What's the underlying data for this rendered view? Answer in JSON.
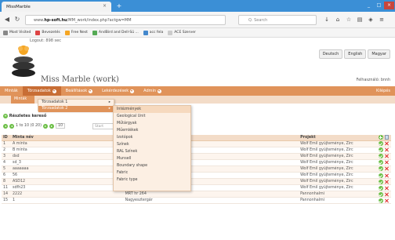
{
  "browser": {
    "tab_title": "MissMarble",
    "close_glyph": "×",
    "newtab_glyph": "+",
    "url_prefix": "www.",
    "url_domain": "hp-soft.hu",
    "url_rest": "/MM_work/index.php?actgw=MM",
    "search_placeholder": "Q. Search",
    "min_glyph": "_",
    "max_glyph": "□",
    "close_win_glyph": "×",
    "bookmarks": [
      {
        "label": "Most Visited",
        "color": "#888"
      },
      {
        "label": "Bevezetés",
        "color": "#d44"
      },
      {
        "label": "Free Nest",
        "color": "#f5a623"
      },
      {
        "label": "AndBird and Dell-Sü ...",
        "color": "#5a5"
      },
      {
        "label": "acc fela",
        "color": "#48c"
      },
      {
        "label": "ACE Szerver",
        "color": "#ccc"
      }
    ]
  },
  "header": {
    "login_note": "Logout: 898 sec",
    "languages": [
      "Deutsch",
      "English",
      "Magyar"
    ],
    "site_title": "Miss Marble (work)",
    "user_right": "Felhasználó: bnnh",
    "logo_icon": "marble-stones-logo"
  },
  "main_nav": {
    "items": [
      {
        "label": "Minták",
        "has_menu": false
      },
      {
        "label": "Törzsadatok",
        "has_menu": true,
        "active": true
      },
      {
        "label": "Beállítások",
        "has_menu": true
      },
      {
        "label": "Lekérdezések",
        "has_menu": true
      },
      {
        "label": "Admin",
        "has_menu": true
      }
    ],
    "right_label": "Kilépés"
  },
  "sub_nav": {
    "active_label": "Minták"
  },
  "dropdown1": {
    "items": [
      "Törzsadatok 1",
      "Törzsadatok 2"
    ],
    "arrow": "▸",
    "selected_index": 1
  },
  "dropdown2": {
    "items": [
      "Intézmények",
      "Geological Unit",
      "Műtárgyak",
      "Műemlékek",
      "Izotópok",
      "Színek",
      "RAL Színek",
      "Munsell",
      "Boundary shape",
      "Fabric",
      "Fabric type"
    ],
    "highlight_index": 0
  },
  "list": {
    "section_title": "Részletes kereső",
    "pager_text": "1 to 10 (0 20)",
    "page_size": "10",
    "prev_glyph": "◂",
    "next_glyph": "▸",
    "filter_placeholder": "Start",
    "columns": [
      "ID",
      "Minta név",
      "",
      "Projekt"
    ],
    "rows": [
      {
        "id": "1",
        "name": "A minta",
        "mid": "",
        "project": "Wolf Emil gyűjteménye, Zirc"
      },
      {
        "id": "2",
        "name": "B minta",
        "mid": "",
        "project": "Wolf Emil gyűjteménye, Zirc"
      },
      {
        "id": "3",
        "name": "dsd",
        "mid": "",
        "project": "Wolf Emil gyűjteménye, Zirc"
      },
      {
        "id": "4",
        "name": "sd_3",
        "mid": "",
        "project": "Wolf Emil gyűjteménye, Zirc"
      },
      {
        "id": "5",
        "name": "aaaaaaa",
        "mid": "",
        "project": "Wolf Emil gyűjteménye, Zirc"
      },
      {
        "id": "6",
        "name": "56",
        "mid": "",
        "project": "Wolf Emil gyűjteménye, Zirc"
      },
      {
        "id": "8",
        "name": "ASD12",
        "mid": "MRT hr 264",
        "project": "Wolf Emil gyűjteménye, Zirc"
      },
      {
        "id": "11",
        "name": "sdfh23",
        "mid": "",
        "project": "Wolf Emil gyűjteménye, Zirc"
      },
      {
        "id": "14",
        "name": "2222",
        "mid": "MRT hr 264",
        "project": "Pannonhalmi"
      },
      {
        "id": "15",
        "name": "1",
        "mid": "Nagyesztergár",
        "project": "Pannonhalmi"
      }
    ]
  }
}
